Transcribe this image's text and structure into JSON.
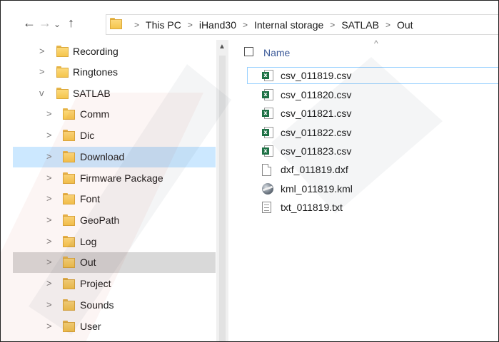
{
  "address_bar": {
    "breadcrumbs": [
      "This PC",
      "iHand30",
      "Internal storage",
      "SATLAB",
      "Out"
    ],
    "separator": ">"
  },
  "nav_buttons": {
    "back": "←",
    "forward": "→",
    "recent": "⌄",
    "up": "↑"
  },
  "navigation_pane": {
    "items": [
      {
        "label": "Recording",
        "level": 1,
        "expanded": false
      },
      {
        "label": "Ringtones",
        "level": 1,
        "expanded": false
      },
      {
        "label": "SATLAB",
        "level": 1,
        "expanded": true
      },
      {
        "label": "Comm",
        "level": 2,
        "expanded": false
      },
      {
        "label": "Dic",
        "level": 2,
        "expanded": false
      },
      {
        "label": "Download",
        "level": 2,
        "expanded": false,
        "state": "selected"
      },
      {
        "label": "Firmware Package",
        "level": 2,
        "expanded": false
      },
      {
        "label": "Font",
        "level": 2,
        "expanded": false
      },
      {
        "label": "GeoPath",
        "level": 2,
        "expanded": false
      },
      {
        "label": "Log",
        "level": 2,
        "expanded": false
      },
      {
        "label": "Out",
        "level": 2,
        "expanded": false,
        "state": "hover"
      },
      {
        "label": "Project",
        "level": 2,
        "expanded": false
      },
      {
        "label": "Sounds",
        "level": 2,
        "expanded": false
      },
      {
        "label": "User",
        "level": 2,
        "expanded": false
      }
    ]
  },
  "file_list": {
    "column_header": "Name",
    "files": [
      {
        "name": "csv_011819.csv",
        "icon": "excel-csv-icon",
        "focused": true
      },
      {
        "name": "csv_011820.csv",
        "icon": "excel-csv-icon"
      },
      {
        "name": "csv_011821.csv",
        "icon": "excel-csv-icon"
      },
      {
        "name": "csv_011822.csv",
        "icon": "excel-csv-icon"
      },
      {
        "name": "csv_011823.csv",
        "icon": "excel-csv-icon"
      },
      {
        "name": "dxf_011819.dxf",
        "icon": "blank-file-icon"
      },
      {
        "name": "kml_011819.kml",
        "icon": "globe-kml-icon"
      },
      {
        "name": "txt_011819.txt",
        "icon": "text-file-icon"
      }
    ]
  },
  "colors": {
    "selected_bg": "#cce8ff",
    "hover_bg": "#d9d9d9",
    "header_text": "#3b5998",
    "folder_yellow": "#f4c54c",
    "excel_green": "#1e7145"
  }
}
